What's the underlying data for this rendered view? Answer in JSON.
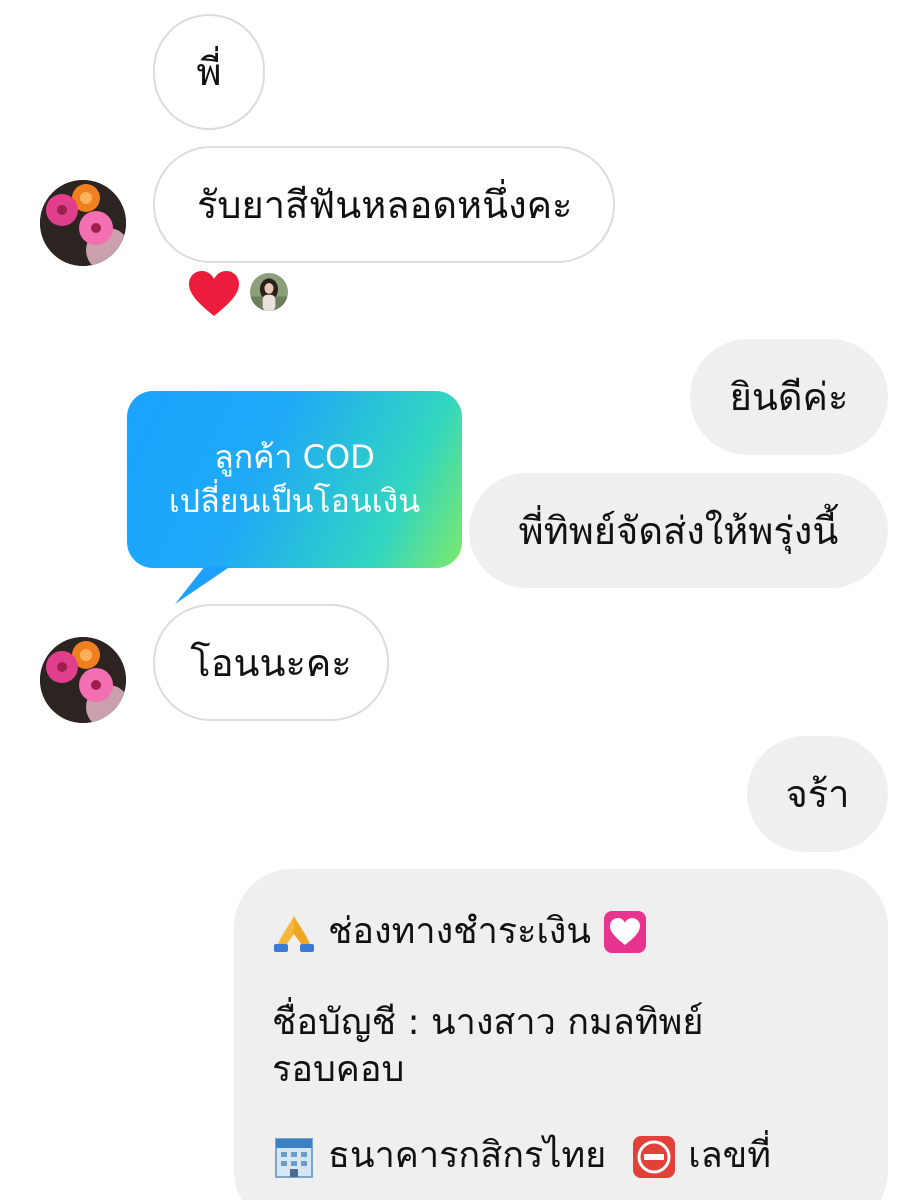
{
  "messages": [
    {
      "side": "incoming",
      "text": "พี่"
    },
    {
      "side": "incoming",
      "text": "รับยาสีฟันหลอดหนึ่งคะ",
      "reaction": "heart"
    },
    {
      "side": "outgoing",
      "text": "ยินดีค่ะ"
    },
    {
      "side": "outgoing",
      "text": "พี่ทิพย์จัดส่งให้พรุ่งนี้"
    },
    {
      "side": "incoming",
      "type": "story_reply",
      "story_lines": [
        "ลูกค้า COD",
        "เปลี่ยนเป็นโอนเงิน"
      ],
      "text": "โอนนะคะ"
    },
    {
      "side": "outgoing",
      "text": "จร้า"
    },
    {
      "side": "outgoing",
      "type": "payment_info",
      "title": "ช่องทางชำระเงิน",
      "account_line1": "ชื่อบัญชี : นางสาว กมลทิพย์",
      "account_line2": "รอบคอบ",
      "bank": "ธนาคารกสิกรไทย",
      "number_label": "เลขที่"
    }
  ],
  "icons": {
    "reaction": "heart-icon",
    "title_prefix": "folded-hands-icon",
    "title_suffix": "heart-box-icon",
    "bank_prefix": "atm-building-icon",
    "number_prefix": "no-entry-icon"
  },
  "colors": {
    "heart": "#ed1c3d",
    "incoming_border": "#dcdcdc",
    "outgoing_bg": "#efefef",
    "story_gradient_start": "#19a4ff",
    "story_gradient_end": "#7ee96a"
  }
}
